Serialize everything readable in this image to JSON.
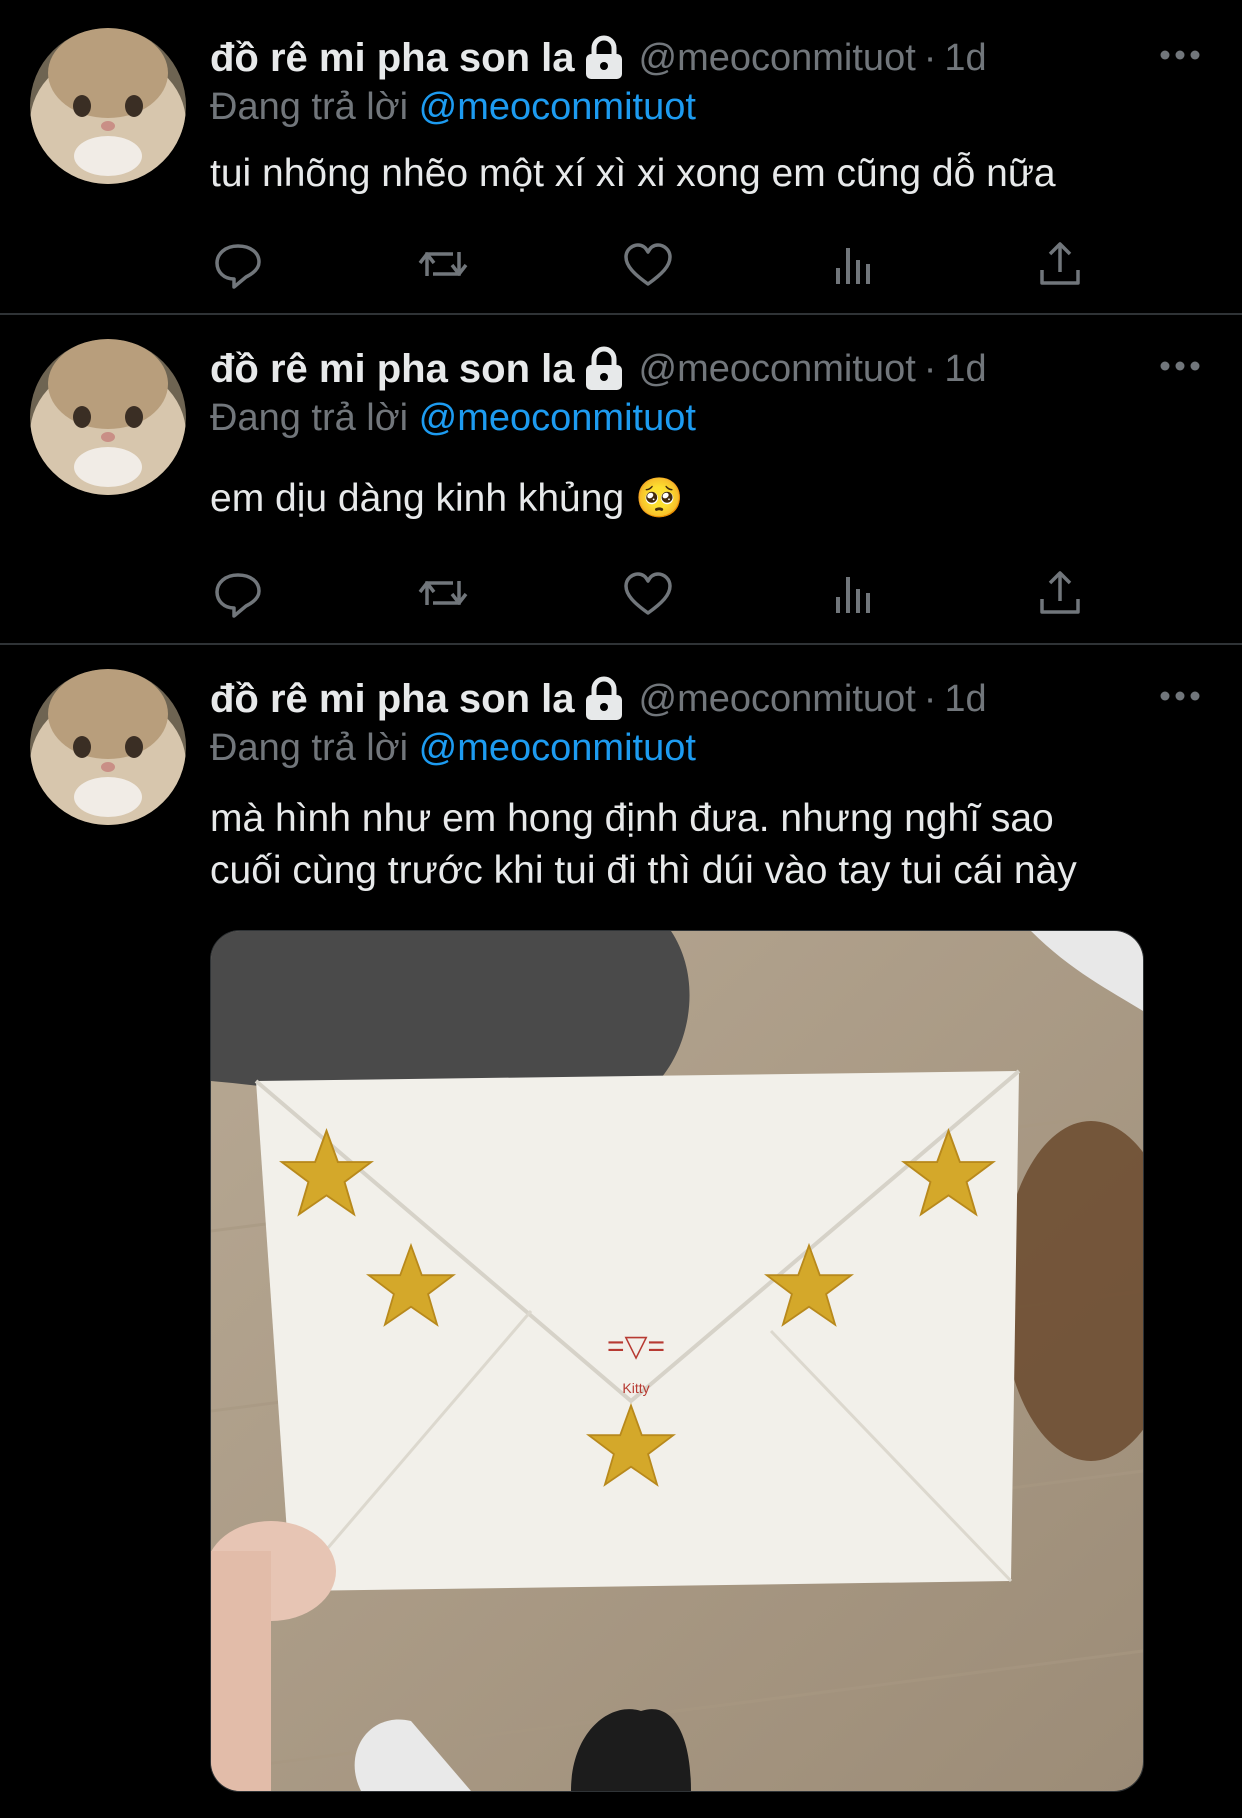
{
  "tweets": [
    {
      "display_name": "đồ rê mi pha son la",
      "handle": "@meoconmituot",
      "separator": "·",
      "time": "1d",
      "replying_label": "Đang trả lời",
      "replying_to": "@meoconmituot",
      "text": "tui nhõng nhẽo một xí xì xi xong em cũng dỗ nữa"
    },
    {
      "display_name": "đồ rê mi pha son la",
      "handle": "@meoconmituot",
      "separator": "·",
      "time": "1d",
      "replying_label": "Đang trả lời",
      "replying_to": "@meoconmituot",
      "text": "em dịu dàng kinh khủng 🥺"
    },
    {
      "display_name": "đồ rê mi pha son la",
      "handle": "@meoconmituot",
      "separator": "·",
      "time": "1d",
      "replying_label": "Đang trả lời",
      "replying_to": "@meoconmituot",
      "text_line1": "mà hình như em hong định đưa. nhưng nghĩ sao",
      "text_line2": "cuối cùng trước khi tui đi thì dúi vào tay tui cái này",
      "media": {
        "envelope_text_1": "=▽=",
        "envelope_text_2": "Kitty"
      }
    }
  ],
  "icons": [
    "lock-icon",
    "more-icon",
    "reply-icon",
    "retweet-icon",
    "like-icon",
    "views-icon",
    "share-icon"
  ],
  "colors": {
    "background": "#000000",
    "text": "#e7e9ea",
    "muted": "#71767b",
    "link": "#1d9bf0",
    "divider": "#2f3336"
  }
}
